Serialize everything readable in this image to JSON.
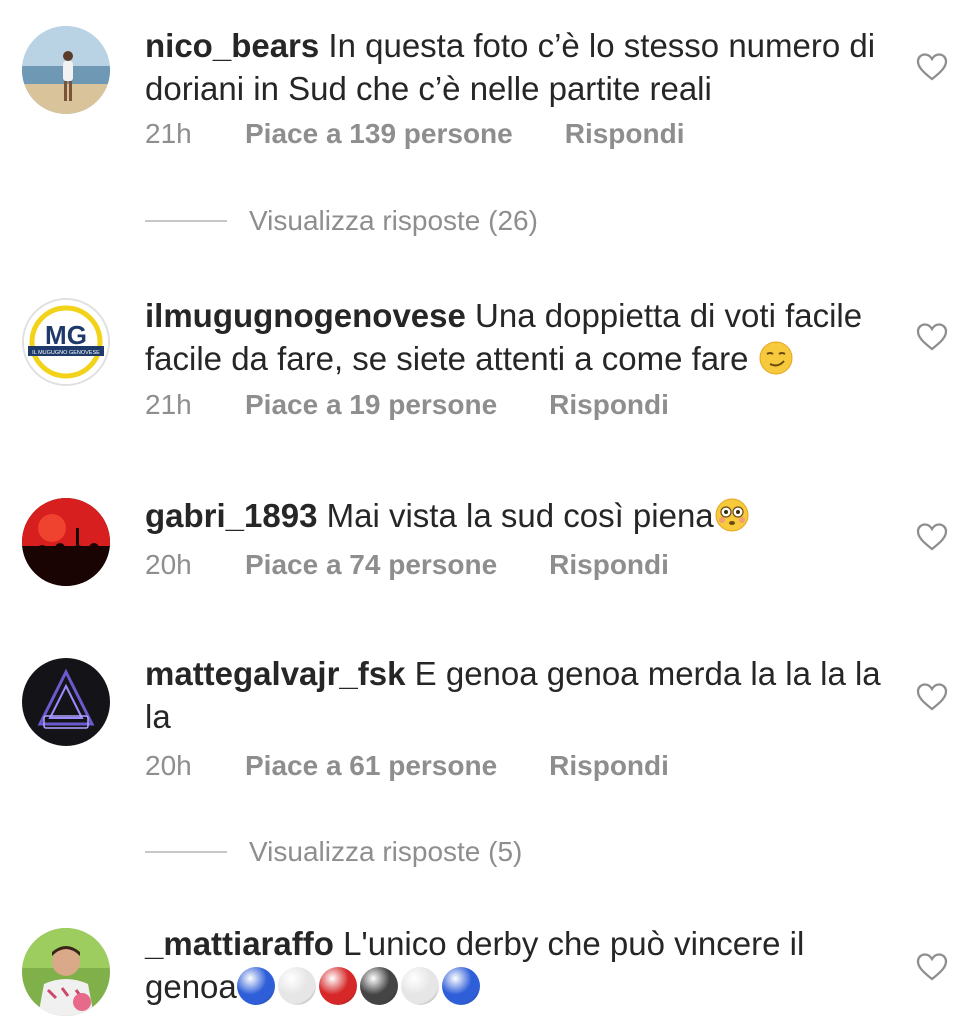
{
  "comments": [
    {
      "username": "nico_bears",
      "text": "In questa foto c’è lo stesso numero di doriani in Sud che c’è nelle partite reali",
      "time": "21h",
      "likes": "Piace a 139 persone",
      "reply": "Rispondi",
      "view_replies": "Visualizza risposte (26)"
    },
    {
      "username": "ilmugugnogenovese",
      "text": "Una doppietta di voti facile facile da fare, se siete attenti a come fare ",
      "emoji": "smirk-face",
      "time": "21h",
      "likes": "Piace a 19 persone",
      "reply": "Rispondi",
      "avatar_logo": "MG",
      "avatar_caption": "IL MUGUGNO GENOVESE"
    },
    {
      "username": "gabri_1893",
      "text": "Mai vista la sud così piena",
      "emoji": "flushed-face",
      "time": "20h",
      "likes": "Piace a 74 persone",
      "reply": "Rispondi"
    },
    {
      "username": "mattegalvajr_fsk",
      "text": "E genoa genoa merda la la la la la",
      "time": "20h",
      "likes": "Piace a 61 persone",
      "reply": "Rispondi",
      "view_replies": "Visualizza risposte (5)"
    },
    {
      "username": "_mattiaraffo",
      "text": "L'unico derby che può vincere il genoa",
      "emoji_balls": [
        "#2f5fd8",
        "#e6e6e6",
        "#d62828",
        "#444444",
        "#e6e6e6",
        "#2f5fd8"
      ]
    }
  ],
  "colors": {
    "text": "#262626",
    "secondary": "#8e8e8e",
    "divider": "#c7c7c7",
    "heart_outline": "#8e8e8e"
  }
}
